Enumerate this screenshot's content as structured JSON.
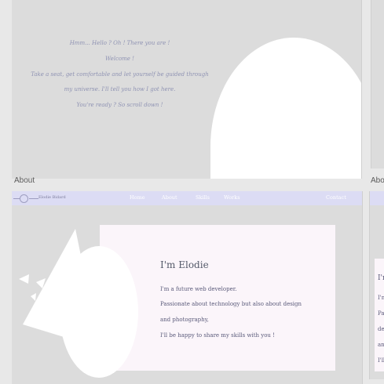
{
  "hero": {
    "lines": [
      "Hmm... Hello ? Oh ! There you are !",
      "Welcome !",
      "Take a seat, get comfortable and let yourself be guided through",
      "my universe. I'll tell you how I got here.",
      "You're ready ? So scroll down !"
    ]
  },
  "labels": {
    "about": "About",
    "about_cut": "Abo"
  },
  "nav": {
    "name": "Elodie Bidard",
    "home": "Home",
    "about": "About",
    "skills": "Skills",
    "works": "Works",
    "contact": "Contact"
  },
  "about": {
    "title": "I'm Elodie",
    "lines": [
      "I'm a future web developer.",
      "Passionate about technology but also about design",
      "and photography,",
      "I'll be happy to share my skills with you !"
    ]
  },
  "sliver": {
    "title": "I'm",
    "lines": [
      "I'm",
      "Pa",
      "de",
      "an",
      "I'll"
    ]
  },
  "colors": {
    "page_bg": "#e8e8e8",
    "frame_bg": "#dcdcdc",
    "navbar_bg": "#dcdcf4",
    "card_bg": "#fbf5fa",
    "hero_text": "#8f93b3"
  }
}
